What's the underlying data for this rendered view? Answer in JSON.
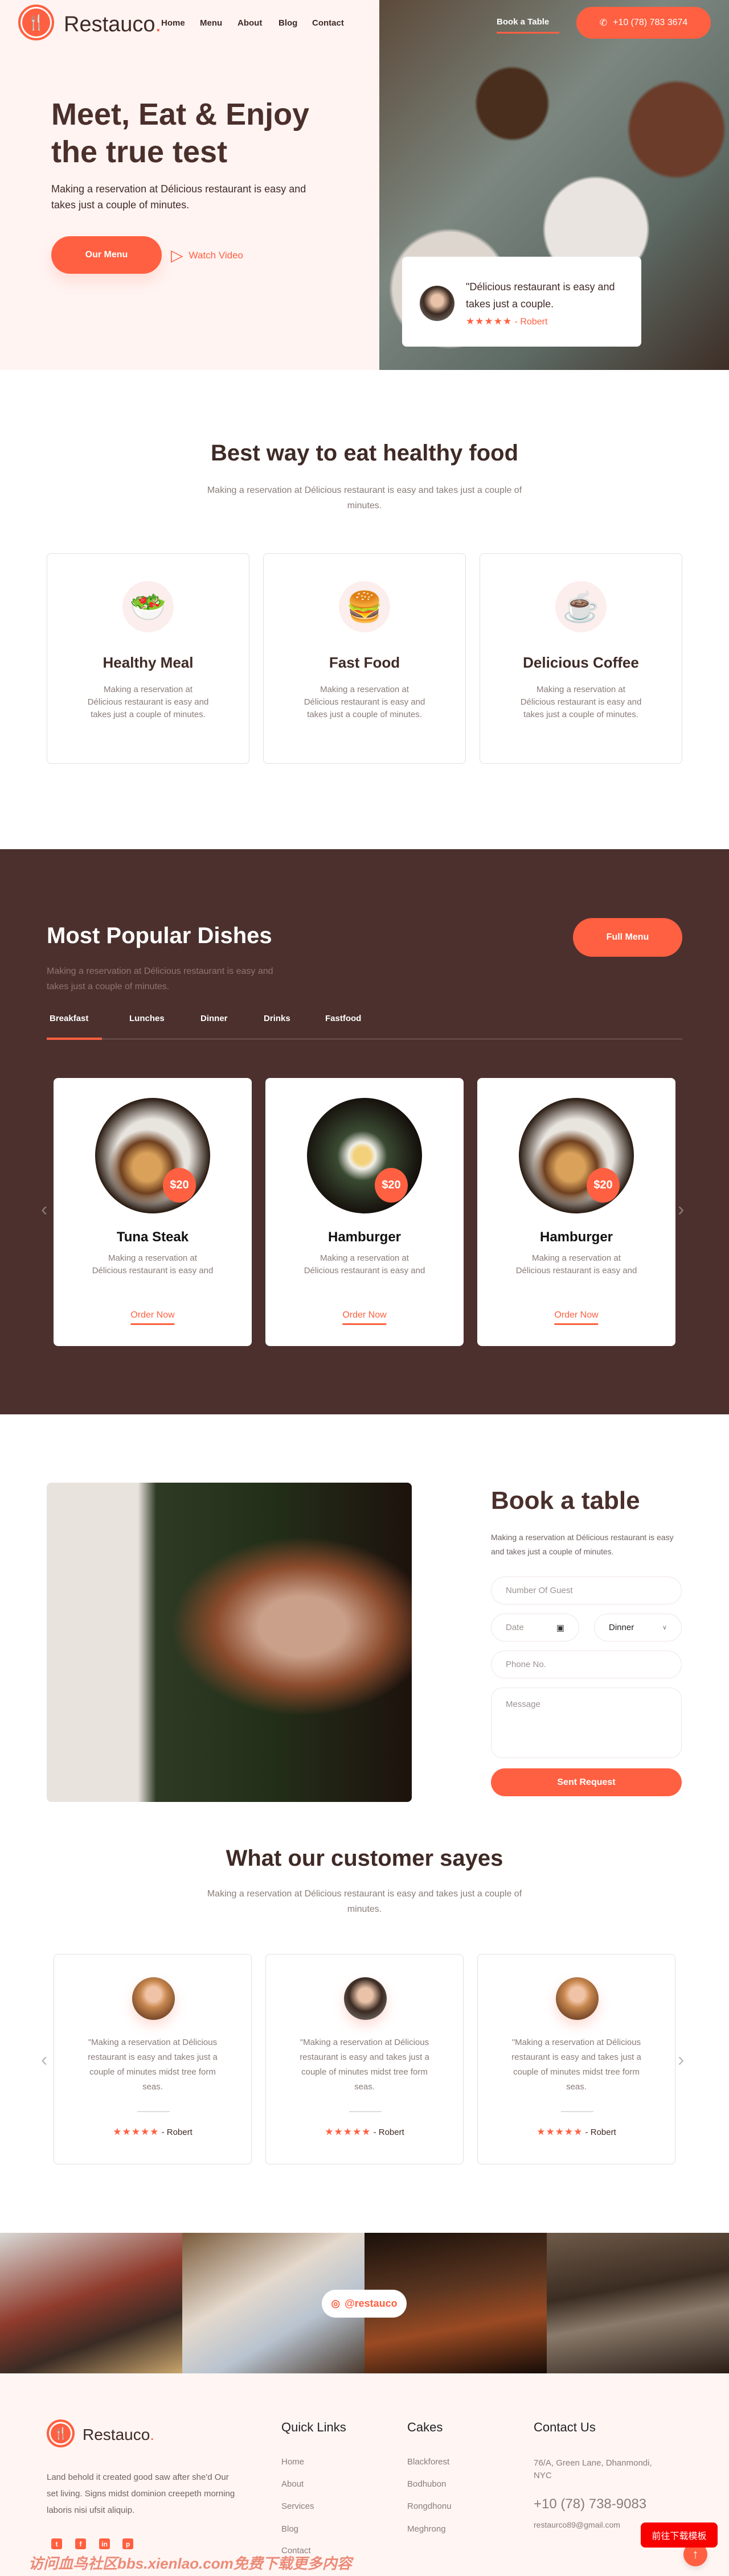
{
  "brand": {
    "name": "Restauco",
    "dot": ".",
    "accent": "#ff6041",
    "dark": "#4b302d"
  },
  "nav": {
    "items": [
      "Home",
      "Menu",
      "About",
      "Blog",
      "Contact"
    ],
    "book": "Book a Table",
    "phone": "+10 (78) 783 3674",
    "phone_icon": "phone-icon"
  },
  "hero": {
    "title_line1": "Meet, Eat & Enjoy",
    "title_line2": "the true test",
    "text": "Making a reservation at Délicious restaurant is easy and takes just a couple of minutes.",
    "menu_button": "Our Menu",
    "video_button": "Watch Video",
    "review": {
      "quote": "\"Délicious restaurant is easy and takes just a couple.",
      "stars": 5,
      "stars_text": "★★★★★",
      "author": "- Robert"
    }
  },
  "features": {
    "title": "Best way to eat healthy food",
    "subtitle": "Making a reservation at Délicious restaurant is easy and takes just a couple of minutes.",
    "items": [
      {
        "icon": "salad-bowl-icon",
        "glyph": "🥗",
        "title": "Healthy Meal",
        "text": "Making a reservation at Délicious restaurant is easy and takes just a couple of minutes."
      },
      {
        "icon": "burger-icon",
        "glyph": "🍔",
        "title": "Fast Food",
        "text": "Making a reservation at Délicious restaurant is easy and takes just a couple of minutes."
      },
      {
        "icon": "coffee-cup-icon",
        "glyph": "☕",
        "title": "Delicious Coffee",
        "text": "Making a reservation at Délicious restaurant is easy and takes just a couple of minutes."
      }
    ]
  },
  "popular": {
    "title": "Most Popular Dishes",
    "subtitle": "Making a reservation at Délicious restaurant is easy and takes just a couple of minutes.",
    "full_menu": "Full Menu",
    "tabs": [
      "Breakfast",
      "Lunches",
      "Dinner",
      "Drinks",
      "Fastfood"
    ],
    "active_tab": "Breakfast",
    "dishes": [
      {
        "name": "Tuna Steak",
        "price": "$20",
        "text": "Making a reservation at Délicious restaurant is easy and",
        "cta": "Order Now"
      },
      {
        "name": "Hamburger",
        "price": "$20",
        "text": "Making a reservation at Délicious restaurant is easy and",
        "cta": "Order Now"
      },
      {
        "name": "Hamburger",
        "price": "$20",
        "text": "Making a reservation at Délicious restaurant is easy and",
        "cta": "Order Now"
      }
    ],
    "prev": "‹",
    "next": "›"
  },
  "booking": {
    "title": "Book a table",
    "text": "Making a reservation at Délicious restaurant is easy and takes just a couple of minutes.",
    "guest_placeholder": "Number Of Guest",
    "date_placeholder": "Date",
    "meal_selected": "Dinner",
    "phone_placeholder": "Phone No.",
    "message_placeholder": "Message",
    "submit": "Sent Request"
  },
  "testimonials": {
    "title": "What our customer sayes",
    "subtitle": "Making a reservation at Délicious restaurant is easy and takes just a couple of minutes.",
    "items": [
      {
        "quote": "\"Making a reservation at Délicious restaurant is easy and takes just a couple of minutes midst tree form seas.",
        "stars": 5,
        "stars_text": "★★★★★",
        "author": "- Robert"
      },
      {
        "quote": "\"Making a reservation at Délicious restaurant is easy and takes just a couple of minutes midst tree form seas.",
        "stars": 5,
        "stars_text": "★★★★★",
        "author": "- Robert"
      },
      {
        "quote": "\"Making a reservation at Délicious restaurant is easy and takes just a couple of minutes midst tree form seas.",
        "stars": 5,
        "stars_text": "★★★★★",
        "author": "- Robert"
      }
    ],
    "prev": "‹",
    "next": "›"
  },
  "gallery": {
    "instagram": "@restauco"
  },
  "footer": {
    "about": "Land behold it created good saw after she'd Our set living. Signs midst dominion creepeth morning laboris nisi ufsit aliquip.",
    "social": [
      "twitter-icon",
      "facebook-icon",
      "linkedin-icon",
      "pinterest-icon"
    ],
    "social_glyphs": [
      "t",
      "f",
      "in",
      "p"
    ],
    "quick_links": {
      "title": "Quick Links",
      "items": [
        "Home",
        "About",
        "Services",
        "Blog",
        "Contact"
      ]
    },
    "cakes": {
      "title": "Cakes",
      "items": [
        "Blackforest",
        "Bodhubon",
        "Rongdhonu",
        "Meghrong"
      ]
    },
    "contact": {
      "title": "Contact Us",
      "address": "76/A, Green Lane, Dhanmondi, NYC",
      "phone": "+10 (78) 738-9083",
      "email": "restaurco89@gmail.com"
    }
  },
  "overlay": {
    "download_badge": "前往下载模板",
    "watermark": "访问血鸟社区bbs.xienlao.com免费下载更多内容",
    "scroll_top": "↑"
  }
}
